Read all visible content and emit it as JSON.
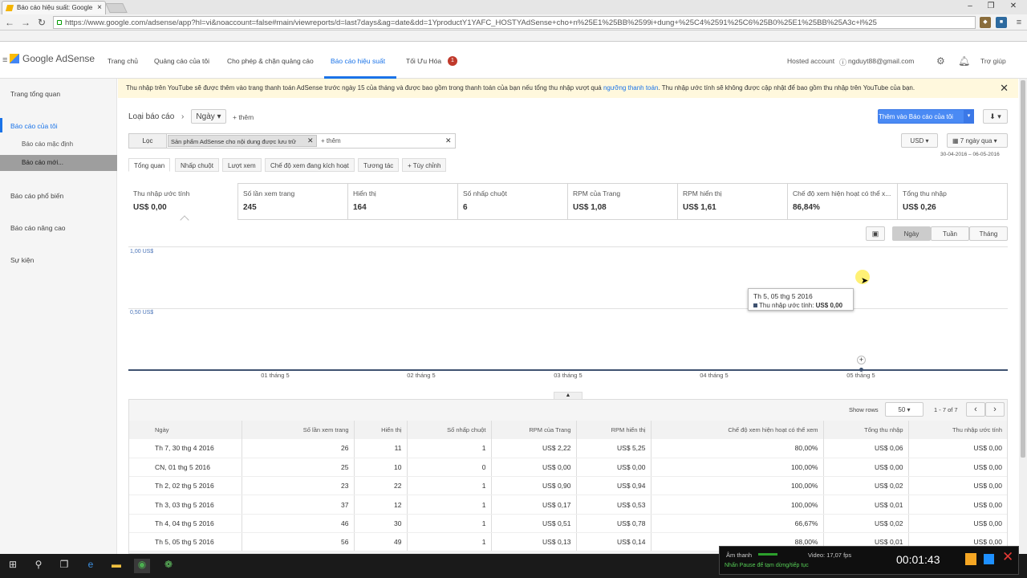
{
  "browser": {
    "tab_title": "Báo cáo hiệu suất: Google",
    "url": "https://www.google.com/adsense/app?hl=vi&noaccount=false#main/viewreports/d=last7days&ag=date&dd=1YproductY1YAFC_HOSTYAdSense+cho+n%25E1%25BB%2599i+dung+%25C4%2591%25C6%25B0%25E1%25BB%25A3c+l%25"
  },
  "header": {
    "logo": "Google AdSense",
    "nav": [
      "Trang chủ",
      "Quảng cáo của tôi",
      "Cho phép & chặn quảng cáo",
      "Báo cáo hiệu suất",
      "Tối Ưu Hóa"
    ],
    "nav_badge": "1",
    "hosted": "Hosted account",
    "email": "ngduyt88@gmail.com",
    "help": "Trợ giúp"
  },
  "sidebar": {
    "overview": "Trang tổng quan",
    "my_reports": "Báo cáo của tôi",
    "default_report": "Báo cáo mặc định",
    "new_report": "Báo cáo mới...",
    "popular": "Báo cáo phổ biến",
    "advanced": "Báo cáo nâng cao",
    "events": "Sự kiện"
  },
  "notice": {
    "text_before": "Thu nhập trên YouTube sẽ được thêm vào trang thanh toán AdSense trước ngày 15 của tháng và được bao gồm trong thanh toán của bạn nếu tổng thu nhập vượt quá ",
    "link": "ngưỡng thanh toán",
    "text_after": ". Thu nhập ước tính sẽ không được cập nhật để bao gồm thu nhập trên YouTube của bạn.",
    "close": "✕"
  },
  "report": {
    "type_label": "Loại báo cáo",
    "type_value": "Ngày",
    "add_more": "+ thêm",
    "filter_label": "Lọc",
    "filter_chip": "Sản phẩm AdSense cho nội dung được lưu trữ",
    "filter_add": "+ thêm",
    "add_btn": "Thêm vào Báo cáo của tôi",
    "currency": "USD",
    "range": "7 ngày qua",
    "dates": "30-04-2016 – 06-05-2016"
  },
  "tabs": [
    "Tổng quan",
    "Nhấp chuột",
    "Lượt xem",
    "Chế độ xem đang kích hoạt",
    "Tương tác",
    "+ Tùy chỉnh"
  ],
  "metrics": [
    {
      "label": "Thu nhập ước tính",
      "value": "US$ 0,00"
    },
    {
      "label": "Số lần xem trang",
      "value": "245"
    },
    {
      "label": "Hiển thị",
      "value": "164"
    },
    {
      "label": "Số nhấp chuột",
      "value": "6"
    },
    {
      "label": "RPM của Trang",
      "value": "US$ 1,08"
    },
    {
      "label": "RPM hiển thị",
      "value": "US$ 1,61"
    },
    {
      "label": "Chế độ xem hiện hoạt có thể x...",
      "value": "86,84%"
    },
    {
      "label": "Tổng thu nhập",
      "value": "US$ 0,26"
    }
  ],
  "granularity": [
    "Ngày",
    "Tuần",
    "Tháng"
  ],
  "chart": {
    "y_labels": [
      "1,00 US$",
      "0,50 US$"
    ],
    "x_labels": [
      "01 tháng 5",
      "02 tháng 5",
      "03 tháng 5",
      "04 tháng 5",
      "05 tháng 5"
    ],
    "tooltip_title": "Th 5, 05 thg 5 2016",
    "tooltip_series": "Thu nhập ước tính:",
    "tooltip_value": "US$ 0,00"
  },
  "table": {
    "show_rows_label": "Show rows",
    "show_rows_value": "50",
    "pagination": "1 - 7 of 7",
    "headers": [
      "Ngày",
      "Số lần xem trang",
      "Hiển thị",
      "Số nhấp chuột",
      "RPM của Trang",
      "RPM hiển thị",
      "Chế độ xem hiện hoạt có thể xem",
      "Tổng thu nhập",
      "Thu nhập ước tính"
    ],
    "rows": [
      [
        "Th 7, 30 thg 4 2016",
        "26",
        "11",
        "1",
        "US$ 2,22",
        "US$ 5,25",
        "80,00%",
        "US$ 0,06",
        "US$ 0,00"
      ],
      [
        "CN, 01 thg 5 2016",
        "25",
        "10",
        "0",
        "US$ 0,00",
        "US$ 0,00",
        "100,00%",
        "US$ 0,00",
        "US$ 0,00"
      ],
      [
        "Th 2, 02 thg 5 2016",
        "23",
        "22",
        "1",
        "US$ 0,90",
        "US$ 0,94",
        "100,00%",
        "US$ 0,02",
        "US$ 0,00"
      ],
      [
        "Th 3, 03 thg 5 2016",
        "37",
        "12",
        "1",
        "US$ 0,17",
        "US$ 0,53",
        "100,00%",
        "US$ 0,01",
        "US$ 0,00"
      ],
      [
        "Th 4, 04 thg 5 2016",
        "46",
        "30",
        "1",
        "US$ 0,51",
        "US$ 0,78",
        "66,67%",
        "US$ 0,02",
        "US$ 0,00"
      ],
      [
        "Th 5, 05 thg 5 2016",
        "56",
        "49",
        "1",
        "US$ 0,13",
        "US$ 0,14",
        "88,00%",
        "US$ 0,01",
        "US$ 0,00"
      ]
    ]
  },
  "recorder": {
    "audio_label": "Âm thanh",
    "video_label": "Video: 17,07 fps",
    "time": "00:01:43",
    "hint": "Nhấn Pause để tạm dừng/tiếp tục"
  },
  "icons": {
    "search": "search-icon",
    "settings": "gear-icon",
    "notifications": "bell-icon",
    "download": "download-icon",
    "calendar": "calendar-icon",
    "comment": "comment-icon"
  }
}
